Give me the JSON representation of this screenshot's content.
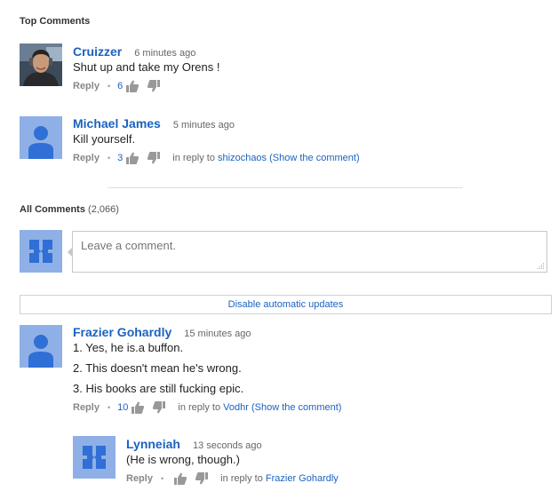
{
  "top_comments": {
    "title": "Top Comments",
    "items": [
      {
        "author": "Cruizzer",
        "time": "6 minutes ago",
        "text": "Shut up and take my Orens !",
        "reply_label": "Reply",
        "likes": "6",
        "avatar": "user-photo"
      },
      {
        "author": "Michael James",
        "time": "5 minutes ago",
        "text": "Kill yourself.",
        "reply_label": "Reply",
        "likes": "3",
        "in_reply_prefix": "in reply to",
        "in_reply_user": "shizochaos",
        "show_comment": "(Show the comment)",
        "avatar": "default-person"
      }
    ]
  },
  "all_comments": {
    "title": "All Comments",
    "count": "(2,066)"
  },
  "new_comment": {
    "placeholder": "Leave a comment."
  },
  "updates_button": {
    "label": "Disable automatic updates"
  },
  "comments": [
    {
      "author": "Frazier Gohardly",
      "time": "15 minutes ago",
      "lines": [
        "1. Yes, he is.a buffon.",
        "2. This doesn't mean he's wrong.",
        "3. His books are still fucking epic."
      ],
      "reply_label": "Reply",
      "likes": "10",
      "in_reply_prefix": "in reply to",
      "in_reply_user": "Vodhr",
      "show_comment": "(Show the comment)",
      "avatar": "default-person"
    },
    {
      "author": "Lynneiah",
      "time": "13 seconds ago",
      "text": "(He is wrong, though.)",
      "reply_label": "Reply",
      "in_reply_prefix": "in reply to",
      "in_reply_user": "Frazier Gohardly",
      "avatar": "default-quilt"
    }
  ],
  "colors": {
    "link": "#1b62c0",
    "avatar_bg": "#8fb0e6",
    "avatar_fg": "#2f6fd6"
  }
}
